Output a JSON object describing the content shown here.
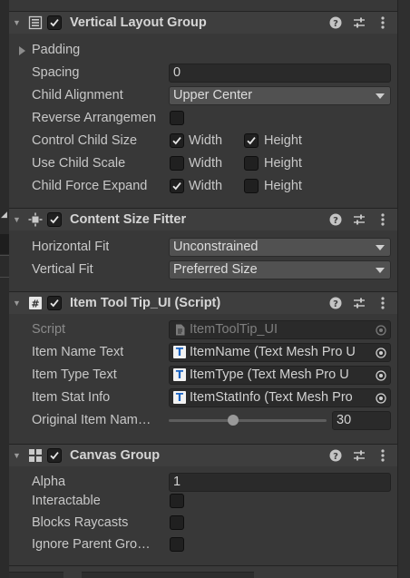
{
  "vertical_layout_group": {
    "title": "Vertical Layout Group",
    "padding_label": "Padding",
    "spacing_label": "Spacing",
    "spacing_value": "0",
    "child_alignment_label": "Child Alignment",
    "child_alignment_value": "Upper Center",
    "reverse_label": "Reverse Arrangemen",
    "reverse_checked": false,
    "control_child_size_label": "Control Child Size",
    "use_child_scale_label": "Use Child Scale",
    "child_force_expand_label": "Child Force Expand",
    "width_label": "Width",
    "height_label": "Height",
    "control_child_size": {
      "width": true,
      "height": true
    },
    "use_child_scale": {
      "width": false,
      "height": false
    },
    "child_force_expand": {
      "width": true,
      "height": false
    }
  },
  "content_size_fitter": {
    "title": "Content Size Fitter",
    "horizontal_fit_label": "Horizontal Fit",
    "horizontal_fit_value": "Unconstrained",
    "vertical_fit_label": "Vertical Fit",
    "vertical_fit_value": "Preferred Size"
  },
  "item_tool_tip": {
    "title": "Item Tool Tip_UI (Script)",
    "script_label": "Script",
    "script_value": "ItemToolTip_UI",
    "item_name_text_label": "Item Name Text",
    "item_name_text_value": "ItemName (Text Mesh Pro U",
    "item_type_text_label": "Item Type Text",
    "item_type_text_value": "ItemType (Text Mesh Pro U",
    "item_stat_info_label": "Item Stat Info",
    "item_stat_info_value": "ItemStatInfo (Text Mesh Pro",
    "original_item_name_label": "Original Item Nam…",
    "original_item_name_value": "30",
    "original_item_name_slider_fraction": 0.4
  },
  "canvas_group": {
    "title": "Canvas Group",
    "alpha_label": "Alpha",
    "alpha_value": "1",
    "interactable_label": "Interactable",
    "blocks_raycasts_label": "Blocks Raycasts",
    "ignore_parent_label": "Ignore Parent Gro…"
  },
  "icons": {
    "help": "help-icon",
    "presets": "presets-icon",
    "menu": "kebab-menu-icon",
    "fold": "foldout-arrow-icon",
    "object_picker": "object-picker-icon",
    "tmp": "text-mesh-pro-icon"
  },
  "colors": {
    "background": "#383838",
    "header": "#3e3e3e",
    "field": "#2a2a2a",
    "dropdown": "#515151",
    "text": "#c8c8c8"
  }
}
